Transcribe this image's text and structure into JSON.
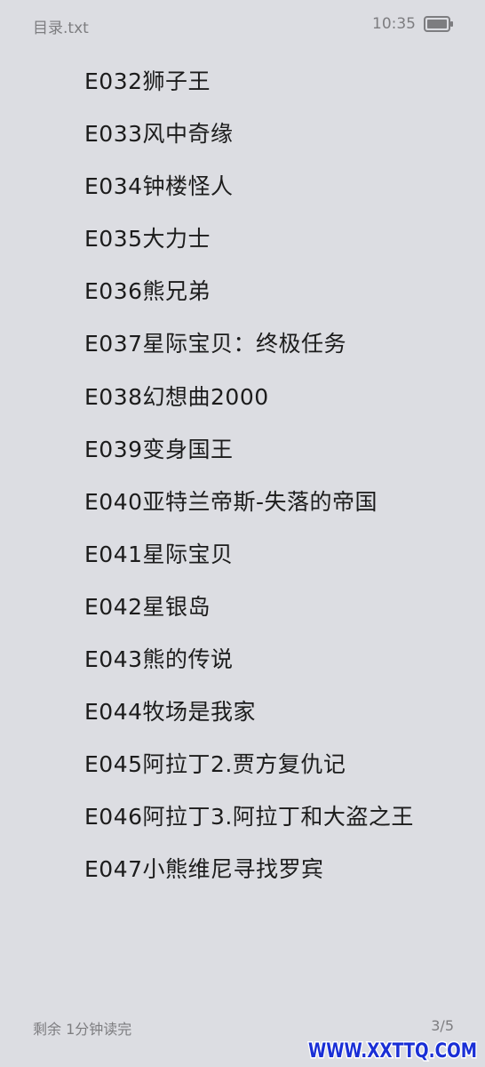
{
  "status_bar": {
    "file_title": "目录.txt",
    "time": "10:35",
    "battery_icon": "battery-icon"
  },
  "content": {
    "lines": [
      "E032狮子王",
      "E033风中奇缘",
      "E034钟楼怪人",
      "E035大力士",
      "E036熊兄弟",
      "E037星际宝贝：终极任务",
      "E038幻想曲2000",
      "E039变身国王",
      "E040亚特兰帝斯-失落的帝国",
      "E041星际宝贝",
      "E042星银岛",
      "E043熊的传说",
      "E044牧场是我家",
      "E045阿拉丁2.贾方复仇记",
      "E046阿拉丁3.阿拉丁和大盗之王",
      "E047小熊维尼寻找罗宾"
    ]
  },
  "footer": {
    "remaining_time": "剩余 1分钟读完",
    "page_indicator": "3/5"
  },
  "watermark": {
    "text": "WWW.XXTTQ.COM",
    "color": "#1a2fd6"
  }
}
